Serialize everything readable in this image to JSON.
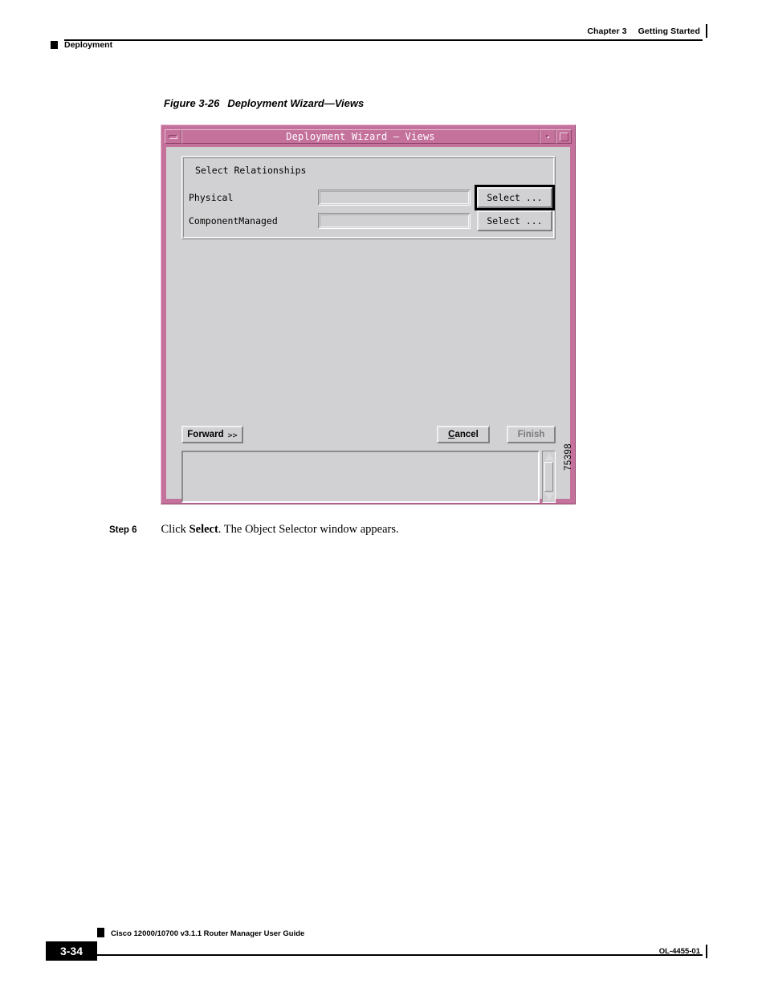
{
  "header": {
    "chapter_number": "Chapter 3",
    "chapter_title": "Getting Started",
    "section": "Deployment"
  },
  "figure": {
    "caption_number": "Figure 3-26",
    "caption_title": "Deployment Wizard—Views",
    "figure_id": "75398"
  },
  "dialog": {
    "title": "Deployment Wizard — Views",
    "title_bar": {
      "menu_button": "window-menu",
      "minimize_button": "minimize",
      "maximize_button": "maximize"
    },
    "group": {
      "legend": "Select Relationships",
      "rows": [
        {
          "label": "Physical",
          "value": "",
          "placeholder": "",
          "button_label": "Select ...",
          "focused": true
        },
        {
          "label": "ComponentManaged",
          "value": "",
          "placeholder": "",
          "button_label": "Select ...",
          "focused": false
        }
      ]
    },
    "buttons": {
      "forward": "Forward",
      "forward_chevron": ">>",
      "cancel_mnemonic": "C",
      "cancel_rest": "ancel",
      "finish": "Finish",
      "finish_enabled": false
    },
    "output": {
      "value": "",
      "scrollbar": {
        "up_arrow": "scroll-up",
        "down_arrow": "scroll-down"
      }
    }
  },
  "step": {
    "label": "Step 6",
    "text_before": "Click ",
    "bold_term": "Select",
    "text_after": ". The Object Selector window appears."
  },
  "footer": {
    "page_number": "3-34",
    "doc_title": "Cisco 12000/10700 v3.1.1 Router Manager User Guide",
    "doc_id": "OL-4455-01"
  },
  "colors": {
    "window_frame": "#c4719c",
    "client_bg": "#d1d1d3",
    "title_text": "#ffffff"
  }
}
